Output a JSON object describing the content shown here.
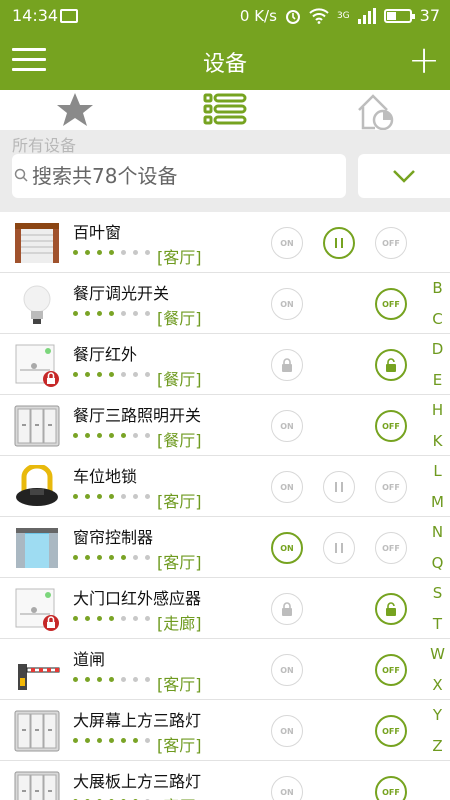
{
  "status_bar": {
    "time": "14:34",
    "net_speed": "0 K/s",
    "signal": "3G",
    "battery": "37",
    "battery_level": 0.37
  },
  "app_bar": {
    "title": "设备",
    "menu_icon": "hamburger-menu-icon",
    "add_icon": "plus-icon",
    "add_symbol": "+"
  },
  "tabs": [
    {
      "icon": "star-icon",
      "active": false
    },
    {
      "icon": "list-icon",
      "active": true
    },
    {
      "icon": "home-pie-icon",
      "active": false
    }
  ],
  "filter": {
    "section_label": "所有设备",
    "search_placeholder": "搜索共78个设备",
    "dropdown_icon": "chevron-down-icon"
  },
  "colors": {
    "accent": "#76a320",
    "accent_text": "#6e9a1f",
    "inactive": "#bdbdbd",
    "tab_inactive": "#9e9e9e"
  },
  "devices": [
    {
      "name": "百叶窗",
      "room": "[客厅]",
      "signal": 4,
      "thumb": "blind-icon",
      "buttons": {
        "on": "ON",
        "mid": "pause",
        "off": "OFF"
      },
      "active": "mid"
    },
    {
      "name": "餐厅调光开关",
      "room": "[餐厅]",
      "signal": 4,
      "thumb": "bulb-icon",
      "buttons": {
        "on": "ON",
        "off": "OFF"
      },
      "active": "off"
    },
    {
      "name": "餐厅红外",
      "room": "[餐厅]",
      "signal": 4,
      "thumb": "ir-sensor-icon",
      "buttons": {
        "on": "lock",
        "off": "unlock"
      },
      "active": "off"
    },
    {
      "name": "餐厅三路照明开关",
      "room": "[餐厅]",
      "signal": 5,
      "thumb": "triple-switch-icon",
      "buttons": {
        "on": "ON",
        "off": "OFF"
      },
      "active": "off"
    },
    {
      "name": "车位地锁",
      "room": "[客厅]",
      "signal": 4,
      "thumb": "parking-lock-icon",
      "buttons": {
        "on": "ON",
        "mid": "pause",
        "off": "OFF"
      },
      "active": "none"
    },
    {
      "name": "窗帘控制器",
      "room": "[客厅]",
      "signal": 5,
      "thumb": "curtain-icon",
      "buttons": {
        "on": "ON",
        "mid": "pause",
        "off": "OFF"
      },
      "active": "on"
    },
    {
      "name": "大门口红外感应器",
      "room": "[走廊]",
      "signal": 4,
      "thumb": "ir-sensor-icon",
      "buttons": {
        "on": "lock",
        "off": "unlock"
      },
      "active": "off"
    },
    {
      "name": "道闸",
      "room": "[客厅]",
      "signal": 4,
      "thumb": "barrier-gate-icon",
      "buttons": {
        "on": "ON",
        "off": "OFF"
      },
      "active": "off"
    },
    {
      "name": "大屏幕上方三路灯",
      "room": "[客厅]",
      "signal": 6,
      "thumb": "triple-switch-icon",
      "buttons": {
        "on": "ON",
        "off": "OFF"
      },
      "active": "off"
    },
    {
      "name": "大展板上方三路灯",
      "room": "[客厅]",
      "signal": 6,
      "thumb": "triple-switch-icon",
      "buttons": {
        "on": "ON",
        "off": "OFF"
      },
      "active": "off"
    }
  ],
  "alpha_index": [
    "B",
    "C",
    "D",
    "E",
    "H",
    "K",
    "L",
    "M",
    "N",
    "Q",
    "S",
    "T",
    "W",
    "X",
    "Y",
    "Z"
  ]
}
